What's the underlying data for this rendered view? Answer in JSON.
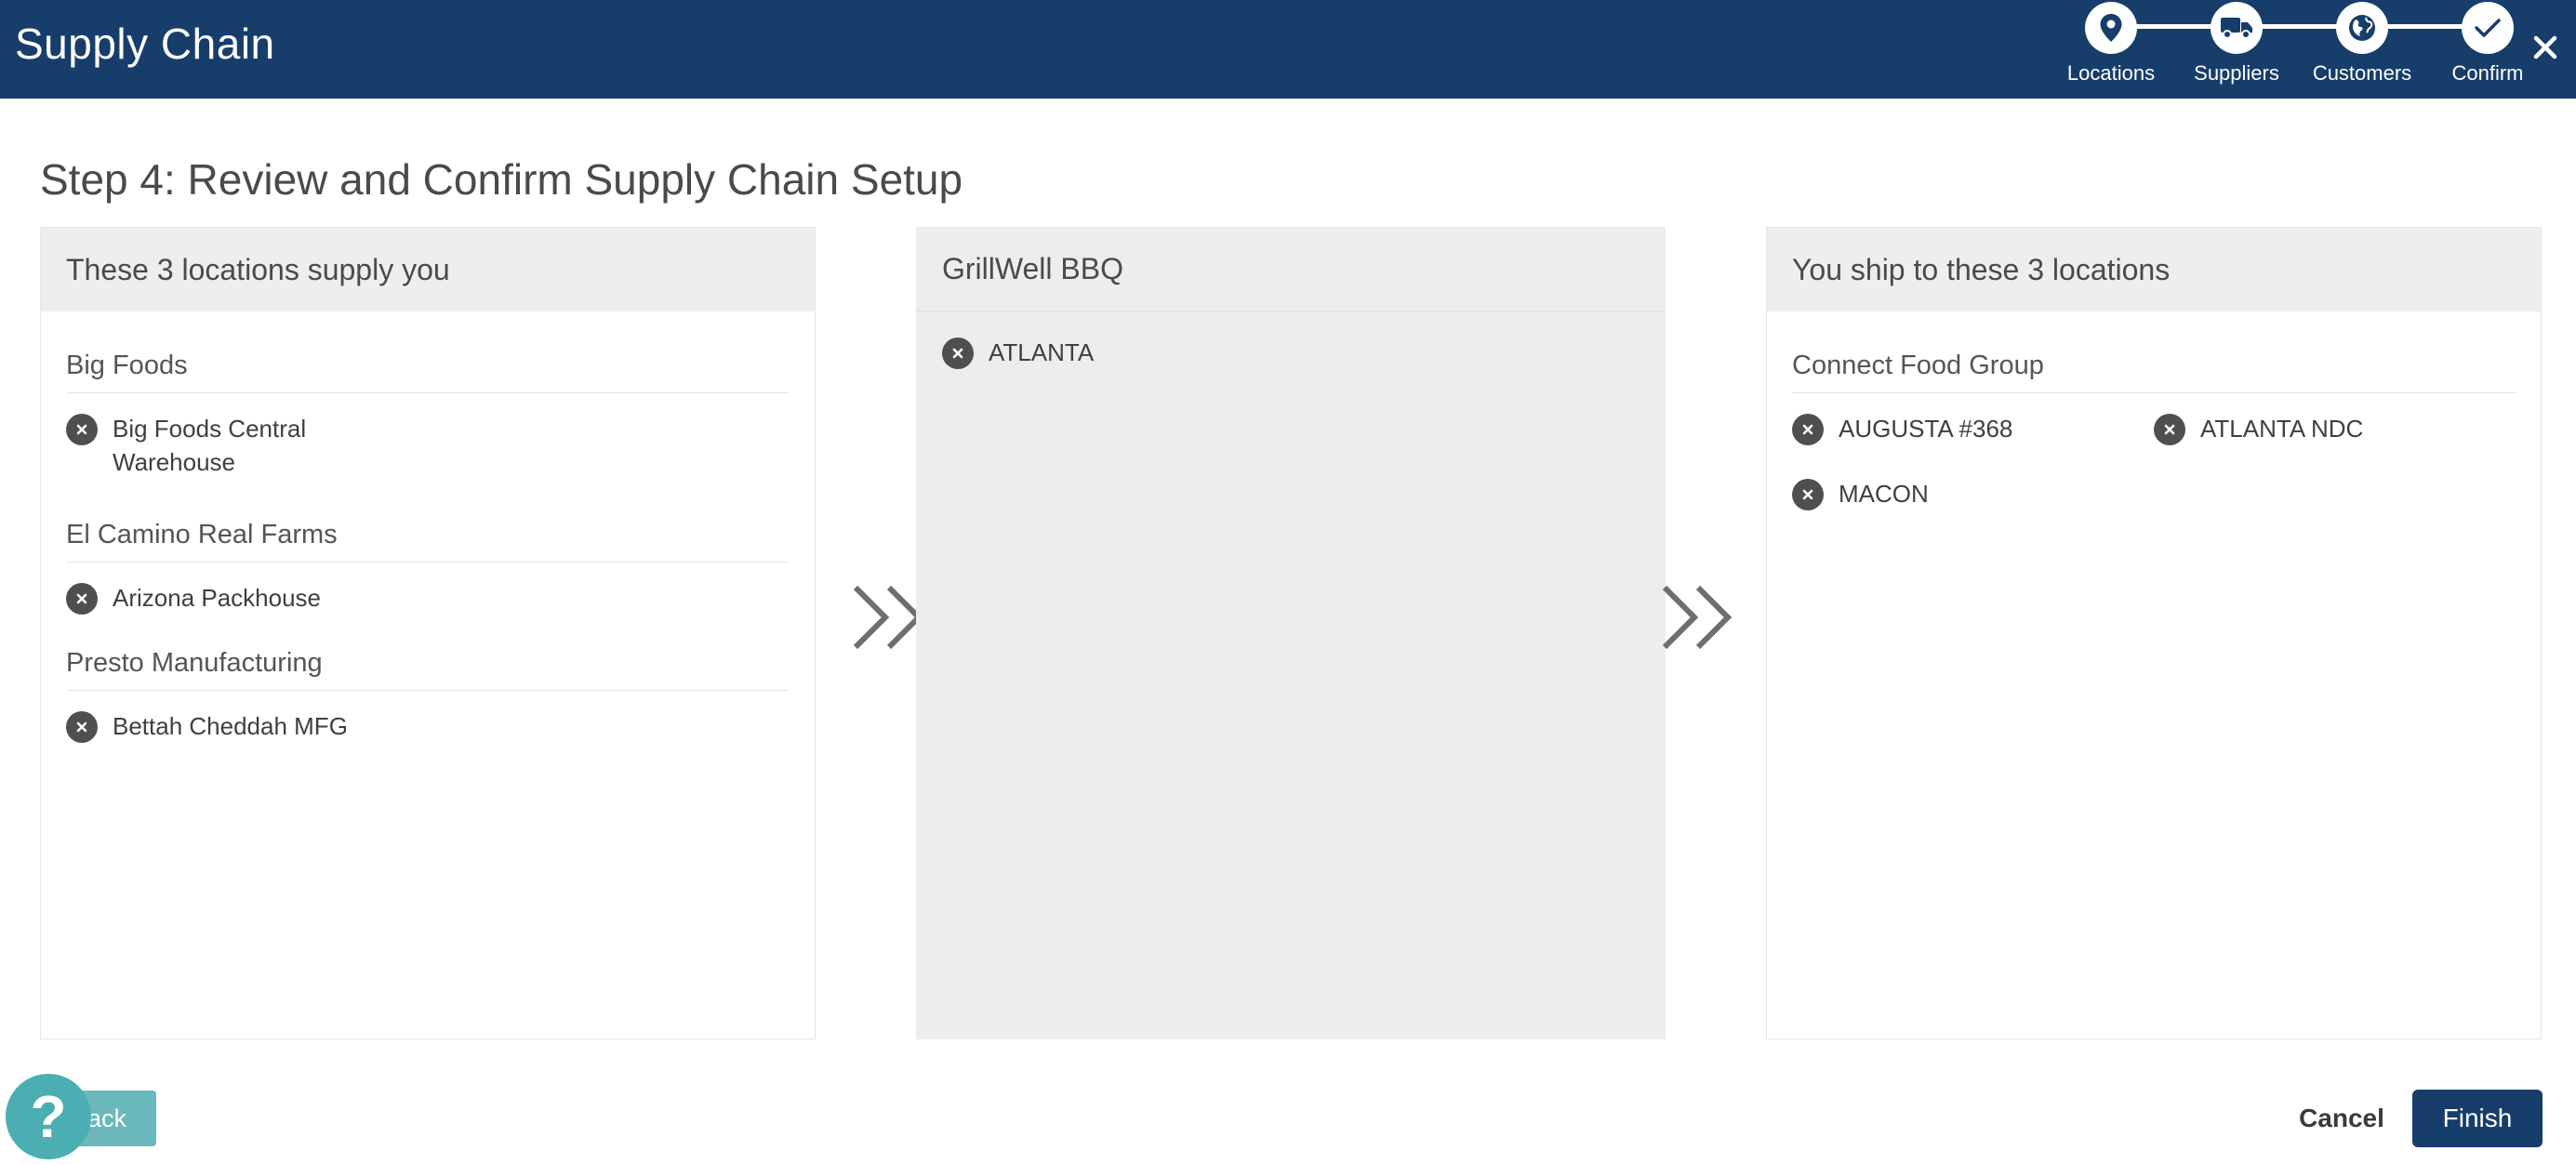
{
  "app": {
    "title": "Supply Chain"
  },
  "stepper": {
    "steps": [
      {
        "label": "Locations",
        "icon": "map-pin-icon"
      },
      {
        "label": "Suppliers",
        "icon": "truck-icon"
      },
      {
        "label": "Customers",
        "icon": "globe-icon"
      },
      {
        "label": "Confirm",
        "icon": "checkmark-icon"
      }
    ],
    "current_step": "Confirm"
  },
  "page": {
    "title": "Step 4: Review and Confirm Supply Chain Setup"
  },
  "suppliers_panel": {
    "title": "These 3 locations supply you",
    "groups": [
      {
        "name": "Big Foods",
        "locations": [
          "Big Foods Central Warehouse"
        ]
      },
      {
        "name": "El Camino Real Farms",
        "locations": [
          "Arizona Packhouse"
        ]
      },
      {
        "name": "Presto Manufacturing",
        "locations": [
          "Bettah Cheddah MFG"
        ]
      }
    ]
  },
  "company_panel": {
    "title": "GrillWell BBQ",
    "locations": [
      "ATLANTA"
    ]
  },
  "customers_panel": {
    "title": "You ship to these 3 locations",
    "groups": [
      {
        "name": "Connect Food Group",
        "locations": [
          "AUGUSTA #368",
          "ATLANTA NDC",
          "MACON"
        ]
      }
    ]
  },
  "footer": {
    "back_label": "ack",
    "help_label": "?",
    "cancel_label": "Cancel",
    "finish_label": "Finish"
  },
  "colors": {
    "header_bg": "#173d6b",
    "accent_teal": "#4aaeb3",
    "panel_header_bg": "#eeeeee",
    "remove_button": "#4f4f4f"
  }
}
